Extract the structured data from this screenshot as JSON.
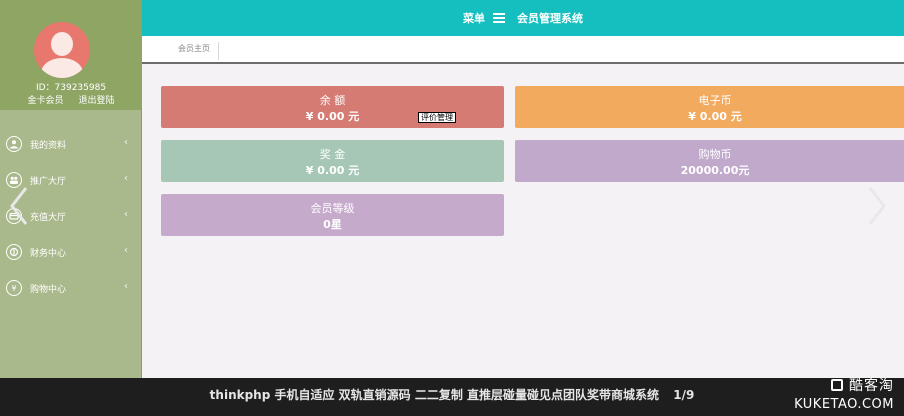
{
  "sidebar": {
    "user_id": "ID：739235985",
    "member_type": "金卡会员",
    "logout_label": "退出登陆",
    "menu": [
      {
        "label": "我的资料",
        "icon": "user-icon"
      },
      {
        "label": "推广大厅",
        "icon": "team-icon"
      },
      {
        "label": "充值大厅",
        "icon": "recharge-icon"
      },
      {
        "label": "财务中心",
        "icon": "finance-icon"
      },
      {
        "label": "购物中心",
        "icon": "yen-icon"
      }
    ]
  },
  "header": {
    "menu_label": "菜单",
    "title": "会员管理系统"
  },
  "tabs": [
    {
      "label": "会员主页"
    }
  ],
  "cards": {
    "balance": {
      "label": "余 额",
      "value": "¥ 0.00 元"
    },
    "ecoin": {
      "label": "电子币",
      "value": "¥ 0.00 元"
    },
    "bonus": {
      "label": "奖 金",
      "value": "¥ 0.00 元"
    },
    "shop": {
      "label": "购物币",
      "value": "20000.00元"
    },
    "level": {
      "label": "会员等级",
      "value": "0星"
    }
  },
  "tooltip": "评价管理",
  "caption": {
    "text": "thinkphp 手机自适应 双轨直销源码 二二复制 直推层碰量碰见点团队奖带商城系统",
    "counter": "1/9"
  },
  "watermark": {
    "name": "酷客淘",
    "domain": "KUKETAO.COM"
  },
  "colors": {
    "topbar": "#15bfc0",
    "sidebar": "#a9b98c",
    "balance": "#d67a74",
    "ecoin": "#f2aa5e",
    "bonus": "#a7c7b6",
    "shop": "#c1a9cb",
    "level": "#c5aacc"
  }
}
